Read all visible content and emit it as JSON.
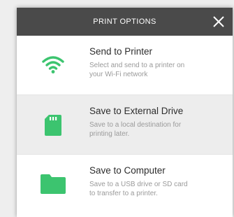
{
  "dialog": {
    "title": "PRINT OPTIONS",
    "close_icon": "close-icon",
    "accent_color": "#3cc46f",
    "options": [
      {
        "icon": "wifi-icon",
        "title": "Send to Printer",
        "description": "Select and send to a printer on your Wi-Fi network"
      },
      {
        "icon": "sd-card-icon",
        "title": "Save to External Drive",
        "description": "Save to a local destination for printing later."
      },
      {
        "icon": "folder-icon",
        "title": "Save to Computer",
        "description": "Save to a USB drive or SD card to transfer to a printer."
      }
    ]
  }
}
